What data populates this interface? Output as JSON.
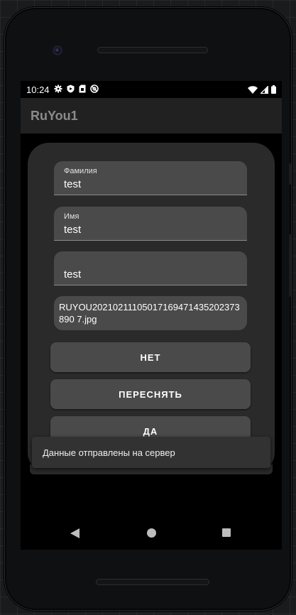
{
  "status": {
    "time": "10:24",
    "left_icons": [
      "gear-icon",
      "shield-icon",
      "sim-card-icon",
      "do-not-disturb-icon"
    ],
    "right_icons": [
      "wifi-icon",
      "signal-icon",
      "battery-icon"
    ]
  },
  "app": {
    "title": "RuYou1"
  },
  "form": {
    "surname": {
      "label": "Фамилия",
      "value": "test"
    },
    "name": {
      "label": "Имя",
      "value": "test"
    },
    "third": {
      "label": "",
      "value": "test"
    },
    "file": {
      "value": "RUYOU20210211105017169471435202373890 7.jpg"
    }
  },
  "buttons": {
    "no": "НЕТ",
    "retake": "ПЕРЕСНЯТЬ",
    "yes": "ДА"
  },
  "snackbar": {
    "message": "Данные отправлены на сервер"
  },
  "nav": {
    "icons": [
      "back-icon",
      "home-icon",
      "recents-icon"
    ]
  }
}
